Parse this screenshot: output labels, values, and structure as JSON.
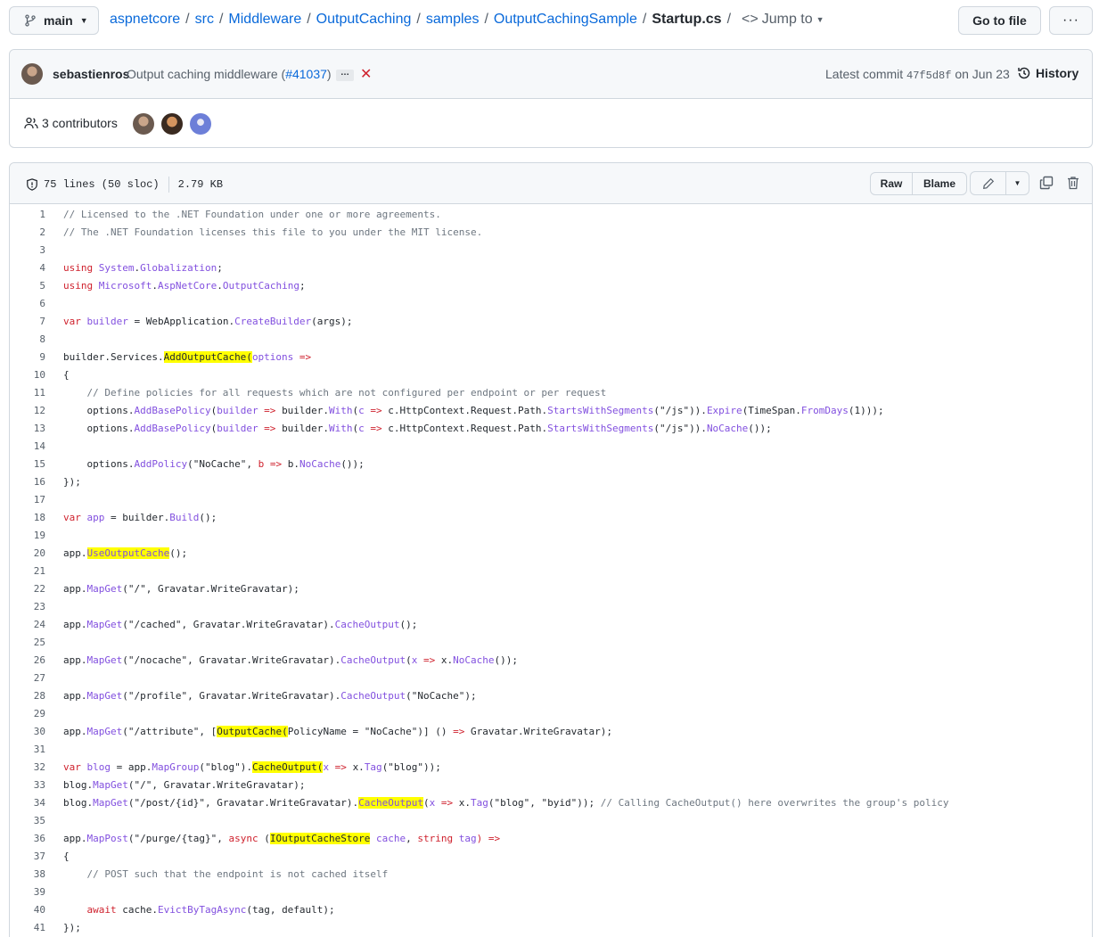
{
  "topbar": {
    "branch": "main",
    "breadcrumb": [
      "aspnetcore",
      "src",
      "Middleware",
      "OutputCaching",
      "samples",
      "OutputCachingSample"
    ],
    "file": "Startup.cs",
    "jump_to": "Jump to",
    "go_to_file": "Go to file",
    "more": "···"
  },
  "commit": {
    "author": "sebastienros",
    "message": "Output caching middleware (",
    "pr": "#41037",
    "message_end": ")",
    "ellipsis": "…",
    "status": "✕",
    "latest_label": "Latest commit",
    "sha": "47f5d8f",
    "date": "on Jun 23",
    "history": "History",
    "contributors": "3 contributors"
  },
  "file": {
    "lines": "75 lines (50 sloc)",
    "size": "2.79 KB",
    "raw": "Raw",
    "blame": "Blame"
  },
  "code": {
    "l1": "// Licensed to the .NET Foundation under one or more agreements.",
    "l2": "// The .NET Foundation licenses this file to you under the MIT license.",
    "l4a": "using ",
    "l4b": "System",
    "l4c": ".",
    "l4d": "Globalization",
    "l4e": ";",
    "l5a": "using ",
    "l5b": "Microsoft",
    "l5c": ".",
    "l5d": "AspNetCore",
    "l5e": ".",
    "l5f": "OutputCaching",
    "l5g": ";",
    "l7a": "var ",
    "l7b": "builder",
    "l7c": " = WebApplication.",
    "l7d": "CreateBuilder",
    "l7e": "(args);",
    "l9a": "builder.Services.",
    "l9b": "AddOutputCache(",
    "l9c": "options",
    "l9d": " =>",
    "l10": "{",
    "l11": "    // Define policies for all requests which are not configured per endpoint or per request",
    "l12a": "    options.",
    "l12b": "AddBasePolicy",
    "l12c": "(",
    "l12d": "builder",
    "l12e": " => ",
    "l12f": "builder.",
    "l12g": "With",
    "l12h": "(",
    "l12i": "c",
    "l12j": " => ",
    "l12k": "c.HttpContext.Request.Path.",
    "l12l": "StartsWithSegments",
    "l12m": "(\"/js\")).",
    "l12n": "Expire",
    "l12o": "(TimeSpan.",
    "l12p": "FromDays",
    "l12q": "(1)));",
    "l13a": "    options.",
    "l13b": "AddBasePolicy",
    "l13c": "(",
    "l13d": "builder",
    "l13e": " => ",
    "l13f": "builder.",
    "l13g": "With",
    "l13h": "(",
    "l13i": "c",
    "l13j": " => ",
    "l13k": "c.HttpContext.Request.Path.",
    "l13l": "StartsWithSegments",
    "l13m": "(\"/js\")).",
    "l13n": "NoCache",
    "l13o": "());",
    "l15a": "    options.",
    "l15b": "AddPolicy",
    "l15c": "(\"NoCache\", ",
    "l15d": "b",
    "l15e": " => ",
    "l15f": "b.",
    "l15g": "NoCache",
    "l15h": "());",
    "l16": "});",
    "l18a": "var ",
    "l18b": "app",
    "l18c": " = builder.",
    "l18d": "Build",
    "l18e": "();",
    "l20a": "app.",
    "l20b": "UseOutputCache",
    "l20c": "();",
    "l22a": "app.",
    "l22b": "MapGet",
    "l22c": "(\"/\", Gravatar.WriteGravatar);",
    "l24a": "app.",
    "l24b": "MapGet",
    "l24c": "(\"/cached\", Gravatar.WriteGravatar).",
    "l24d": "CacheOutput",
    "l24e": "();",
    "l26a": "app.",
    "l26b": "MapGet",
    "l26c": "(\"/nocache\", Gravatar.WriteGravatar).",
    "l26d": "CacheOutput",
    "l26e": "(",
    "l26f": "x",
    "l26g": " => ",
    "l26h": "x.",
    "l26i": "NoCache",
    "l26j": "());",
    "l28a": "app.",
    "l28b": "MapGet",
    "l28c": "(\"/profile\", Gravatar.WriteGravatar).",
    "l28d": "CacheOutput",
    "l28e": "(\"NoCache\");",
    "l30a": "app.",
    "l30b": "MapGet",
    "l30c": "(\"/attribute\", [",
    "l30d": "OutputCache(",
    "l30e": "PolicyName = \"NoCache\")] () ",
    "l30f": "=>",
    "l30g": " Gravatar.WriteGravatar);",
    "l32a": "var ",
    "l32b": "blog",
    "l32c": " = app.",
    "l32d": "MapGroup",
    "l32e": "(\"blog\").",
    "l32f": "CacheOutput(",
    "l32g": "x",
    "l32h": " => ",
    "l32i": "x.",
    "l32j": "Tag",
    "l32k": "(\"blog\"));",
    "l33a": "blog.",
    "l33b": "MapGet",
    "l33c": "(\"/\", Gravatar.WriteGravatar);",
    "l34a": "blog.",
    "l34b": "MapGet",
    "l34c": "(\"/post/{id}\", Gravatar.WriteGravatar).",
    "l34d": "CacheOutput",
    "l34e": "(",
    "l34f": "x",
    "l34g": " => ",
    "l34h": "x.",
    "l34i": "Tag",
    "l34j": "(\"blog\", \"byid\")); ",
    "l34k": "// Calling CacheOutput() here overwrites the group's policy",
    "l36a": "app.",
    "l36b": "MapPost",
    "l36c": "(\"/purge/{tag}\", ",
    "l36d": "async",
    "l36e": " (",
    "l36f": "IOutputCacheStore",
    "l36g": " cache",
    "l36h": ", ",
    "l36i": "string",
    "l36j": " tag",
    "l36k": ") =>",
    "l37": "{",
    "l38": "    // POST such that the endpoint is not cached itself",
    "l40a": "    await ",
    "l40b": "cache.",
    "l40c": "EvictByTagAsync",
    "l40d": "(tag, default);",
    "l41": "});"
  }
}
